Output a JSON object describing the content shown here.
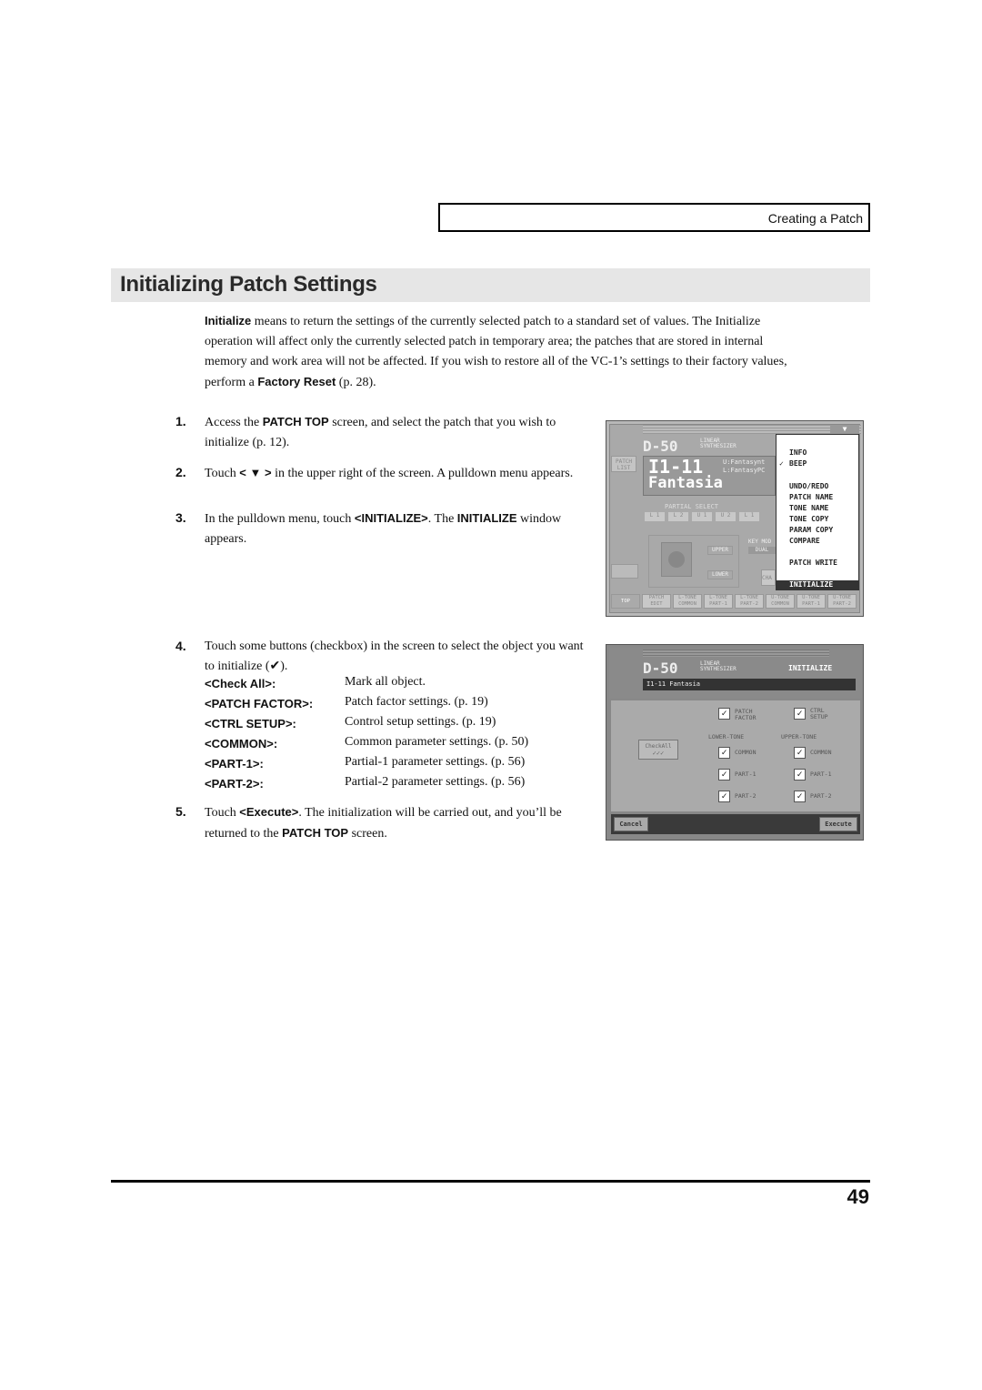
{
  "header": {
    "section": "Creating a Patch"
  },
  "title": "Initializing Patch Settings",
  "intro": {
    "bold": "Initialize",
    "text1": " means to return the settings of the currently selected patch to a standard set of values. The Initialize operation will affect only the currently selected patch in temporary area; the patches that are stored in internal memory and work area will not be affected. If you wish to restore all of the VC-1’s settings to their factory values, perform a ",
    "bold2": "Factory Reset",
    "text2": " (p. 28)."
  },
  "steps": [
    {
      "num": "1.",
      "a": "Access the ",
      "b": "PATCH TOP",
      "c": " screen, and select the patch that you wish to initialize (p. 12)."
    },
    {
      "num": "2.",
      "a": "Touch ",
      "b": "< ▼ >",
      "c": " in the upper right of the screen. A pulldown menu appears."
    },
    {
      "num": "3.",
      "a": "In the pulldown menu, touch ",
      "b": "<INITIALIZE>",
      "c": ". The ",
      "d": "INITIALIZE",
      "e": " window appears."
    },
    {
      "num": "4.",
      "a": "Touch some  buttons (checkbox) in the screen to select the object you want to initialize (✔)."
    },
    {
      "num": "5.",
      "a": "Touch ",
      "b": "<Execute>",
      "c": ". The initialization will be carried out, and you’ll be returned to the ",
      "d": "PATCH TOP",
      "e": " screen."
    }
  ],
  "definitions": [
    {
      "term": "<Check All>:",
      "desc": "Mark all object."
    },
    {
      "term": "<PATCH FACTOR>:",
      "desc": "Patch factor settings. (p. 19)"
    },
    {
      "term": "<CTRL SETUP>:",
      "desc": "Control setup settings. (p. 19)"
    },
    {
      "term": "<COMMON>:",
      "desc": "Common parameter settings. (p. 50)"
    },
    {
      "term": "<PART-1>:",
      "desc": "Partial-1 parameter settings. (p. 56)"
    },
    {
      "term": "<PART-2>:",
      "desc": "Partial-2 parameter settings. (p. 56)"
    }
  ],
  "screen1": {
    "logo": "D-50",
    "logo_sub": "LINEAR SYNTHESIZER",
    "patch_list": "PATCH LIST",
    "patch_num": "I1-11",
    "patch_name": "Fantasia",
    "upper": "U:Fantasynt",
    "lower": "L:FantasyPC",
    "partial_select": "PARTIAL SELECT",
    "partials": [
      "L 1",
      "L 2",
      "U 1",
      "U 2",
      "L 1"
    ],
    "key_mode": "KEY MOD",
    "dual": "DUAL",
    "upper_btn": "UPPER",
    "lower_btn": "LOWER",
    "chase": "CHA",
    "menu": [
      "INFO",
      "BEEP",
      "UNDO/REDO",
      "PATCH NAME",
      "TONE NAME",
      "TONE COPY",
      "PARAM COPY",
      "COMPARE",
      "PATCH WRITE",
      "INITIALIZE"
    ],
    "beep_check": "✓",
    "tabs": [
      "TOP",
      "PATCH EDIT",
      "L-TONE COMMON",
      "L-TONE PART-1",
      "L-TONE PART-2",
      "U-TONE COMMON",
      "U-TONE PART-1",
      "U-TONE PART-2"
    ]
  },
  "screen2": {
    "logo": "D-50",
    "logo_sub": "LINEAR SYNTHESIZER",
    "window_title": "INITIALIZE",
    "patch": "I1-11 Fantasia",
    "check_all": "CheckAll",
    "patch_factor": "PATCH FACTOR",
    "ctrl_setup": "CTRL SETUP",
    "lower_tone": "LOWER-TONE",
    "upper_tone": "UPPER-TONE",
    "common": "COMMON",
    "part1": "PART-1",
    "part2": "PART-2",
    "cancel": "Cancel",
    "execute": "Execute",
    "check": "✓"
  },
  "page_number": "49"
}
